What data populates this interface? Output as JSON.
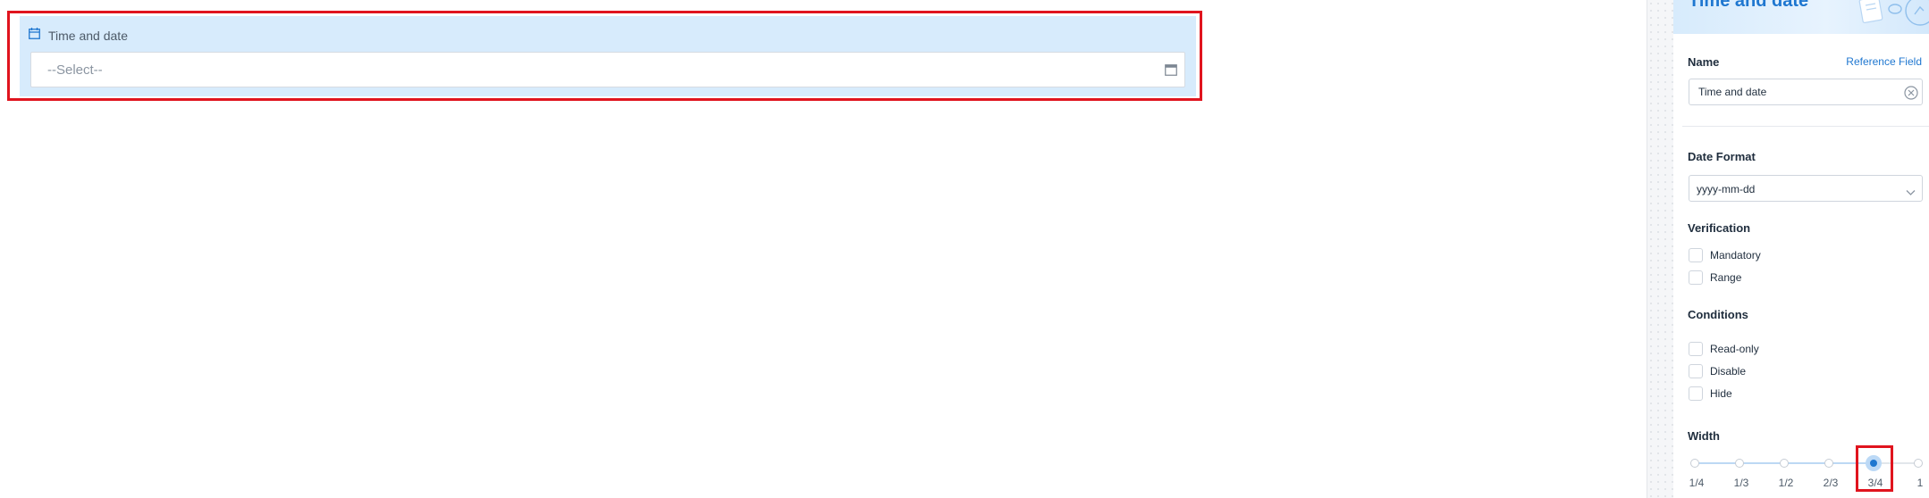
{
  "canvas": {
    "field": {
      "label": "Time and date",
      "placeholder": "--Select--",
      "label_icon": "calendar-icon",
      "input_icon": "calendar-icon"
    }
  },
  "panel": {
    "title": "Time and date",
    "name": {
      "label": "Name",
      "reference_link": "Reference Field",
      "value": "Time and date",
      "clear_icon": "clear-circle-icon"
    },
    "date_format": {
      "label": "Date Format",
      "value": "yyyy-mm-dd",
      "dropdown_icon": "chevron-down-icon"
    },
    "verification": {
      "label": "Verification",
      "options": [
        {
          "label": "Mandatory",
          "checked": false
        },
        {
          "label": "Range",
          "checked": false
        }
      ]
    },
    "conditions": {
      "label": "Conditions",
      "options": [
        {
          "label": "Read-only",
          "checked": false
        },
        {
          "label": "Disable",
          "checked": false
        },
        {
          "label": "Hide",
          "checked": false
        }
      ]
    },
    "width": {
      "label": "Width",
      "marks": [
        "1/4",
        "1/3",
        "1/2",
        "2/3",
        "3/4",
        "1"
      ],
      "selected": "3/4"
    }
  },
  "colors": {
    "accent": "#1f77d0",
    "highlight": "#e0141e",
    "field_background": "#d7ebfc"
  }
}
